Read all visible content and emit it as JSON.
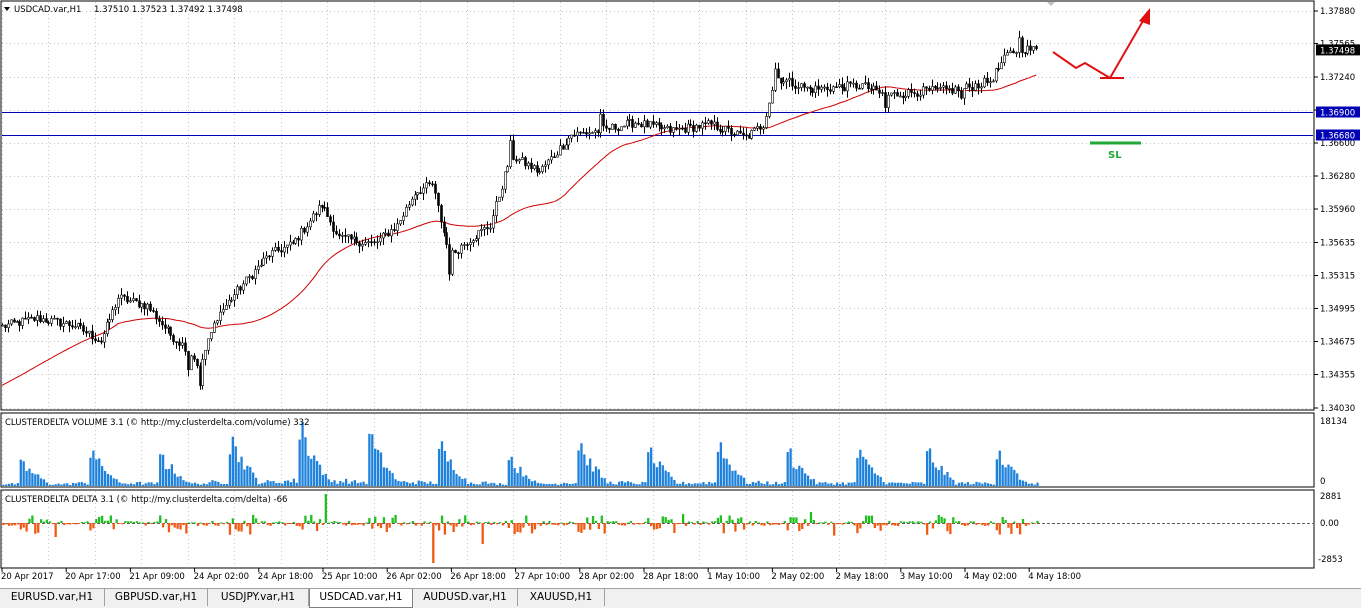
{
  "window": {
    "symbol_label": "USDCAD.var,H1",
    "ohlc": "1.37510 1.37523 1.37492 1.37498"
  },
  "chart_data": [
    {
      "type": "candlestick",
      "price_ticks": [
        "1.37880",
        "1.37565",
        "1.37240",
        "1.36920",
        "1.36600",
        "1.36280",
        "1.35960",
        "1.35635",
        "1.35315",
        "1.34995",
        "1.34675",
        "1.34355",
        "1.34030"
      ],
      "ylim": [
        1.3403,
        1.3788
      ],
      "current_price": "1.37498",
      "hlines": [
        {
          "price": "1.36900",
          "color": "#0000b4"
        },
        {
          "price": "1.36680",
          "color": "#0000b4"
        }
      ],
      "moving_average_color": "#d10000",
      "annotation_text": "SL",
      "annotation_color": "#22a838",
      "arrow_color": "#e01010",
      "time_ticks": [
        "20 Apr 2017",
        "20 Apr 17:00",
        "21 Apr 09:00",
        "24 Apr 02:00",
        "24 Apr 18:00",
        "25 Apr 10:00",
        "26 Apr 02:00",
        "26 Apr 18:00",
        "27 Apr 10:00",
        "28 Apr 02:00",
        "28 Apr 18:00",
        "1 May 10:00",
        "2 May 02:00",
        "2 May 18:00",
        "3 May 10:00",
        "4 May 02:00",
        "4 May 18:00"
      ],
      "close_anchors": [
        [
          0,
          1.3482
        ],
        [
          12,
          1.349
        ],
        [
          25,
          1.3483
        ],
        [
          34,
          1.3468
        ],
        [
          40,
          1.351
        ],
        [
          50,
          1.3502
        ],
        [
          58,
          1.3474
        ],
        [
          64,
          1.346
        ],
        [
          68,
          1.3442
        ],
        [
          74,
          1.3492
        ],
        [
          82,
          1.352
        ],
        [
          92,
          1.3552
        ],
        [
          100,
          1.3562
        ],
        [
          110,
          1.36
        ],
        [
          116,
          1.3568
        ],
        [
          128,
          1.3562
        ],
        [
          136,
          1.358
        ],
        [
          142,
          1.3612
        ],
        [
          148,
          1.362
        ],
        [
          154,
          1.355
        ],
        [
          160,
          1.3565
        ],
        [
          168,
          1.358
        ],
        [
          175,
          1.3648
        ],
        [
          185,
          1.3632
        ],
        [
          196,
          1.3668
        ],
        [
          206,
          1.3672
        ],
        [
          218,
          1.368
        ],
        [
          230,
          1.3672
        ],
        [
          244,
          1.3678
        ],
        [
          256,
          1.3665
        ],
        [
          262,
          1.3678
        ],
        [
          266,
          1.3724
        ],
        [
          278,
          1.3712
        ],
        [
          296,
          1.3716
        ],
        [
          304,
          1.3706
        ],
        [
          316,
          1.371
        ],
        [
          330,
          1.3712
        ],
        [
          340,
          1.372
        ],
        [
          346,
          1.3745
        ],
        [
          350,
          1.3752
        ],
        [
          356,
          1.375
        ]
      ]
    },
    {
      "type": "bar",
      "title": "CLUSTERDELTA VOLUME 3.1 (© http://my.clusterdelta.com/volume) 332",
      "ticks": [
        "18134",
        "0"
      ],
      "ylim": [
        0,
        18134
      ],
      "color": "#1e82dc",
      "session_peaks": [
        7000,
        10000,
        9000,
        14000,
        18000,
        14000,
        12000,
        8000,
        12000,
        10000,
        12000,
        10000
      ]
    },
    {
      "type": "bar",
      "title": "CLUSTERDELTA DELTA 3.1 (© http://my.clusterdelta.com/delta) -66",
      "ticks": [
        "2881",
        "0.00",
        "-2853"
      ],
      "ylim": [
        -2853,
        2881
      ],
      "positive_color": "#21be21",
      "negative_color": "#f05a14"
    }
  ],
  "tabs": [
    {
      "label": "EURUSD.var,H1"
    },
    {
      "label": "GBPUSD.var,H1"
    },
    {
      "label": "USDJPY.var,H1"
    },
    {
      "label": "USDCAD.var,H1",
      "active": true
    },
    {
      "label": "AUDUSD.var,H1"
    },
    {
      "label": "XAUUSD,H1"
    }
  ]
}
